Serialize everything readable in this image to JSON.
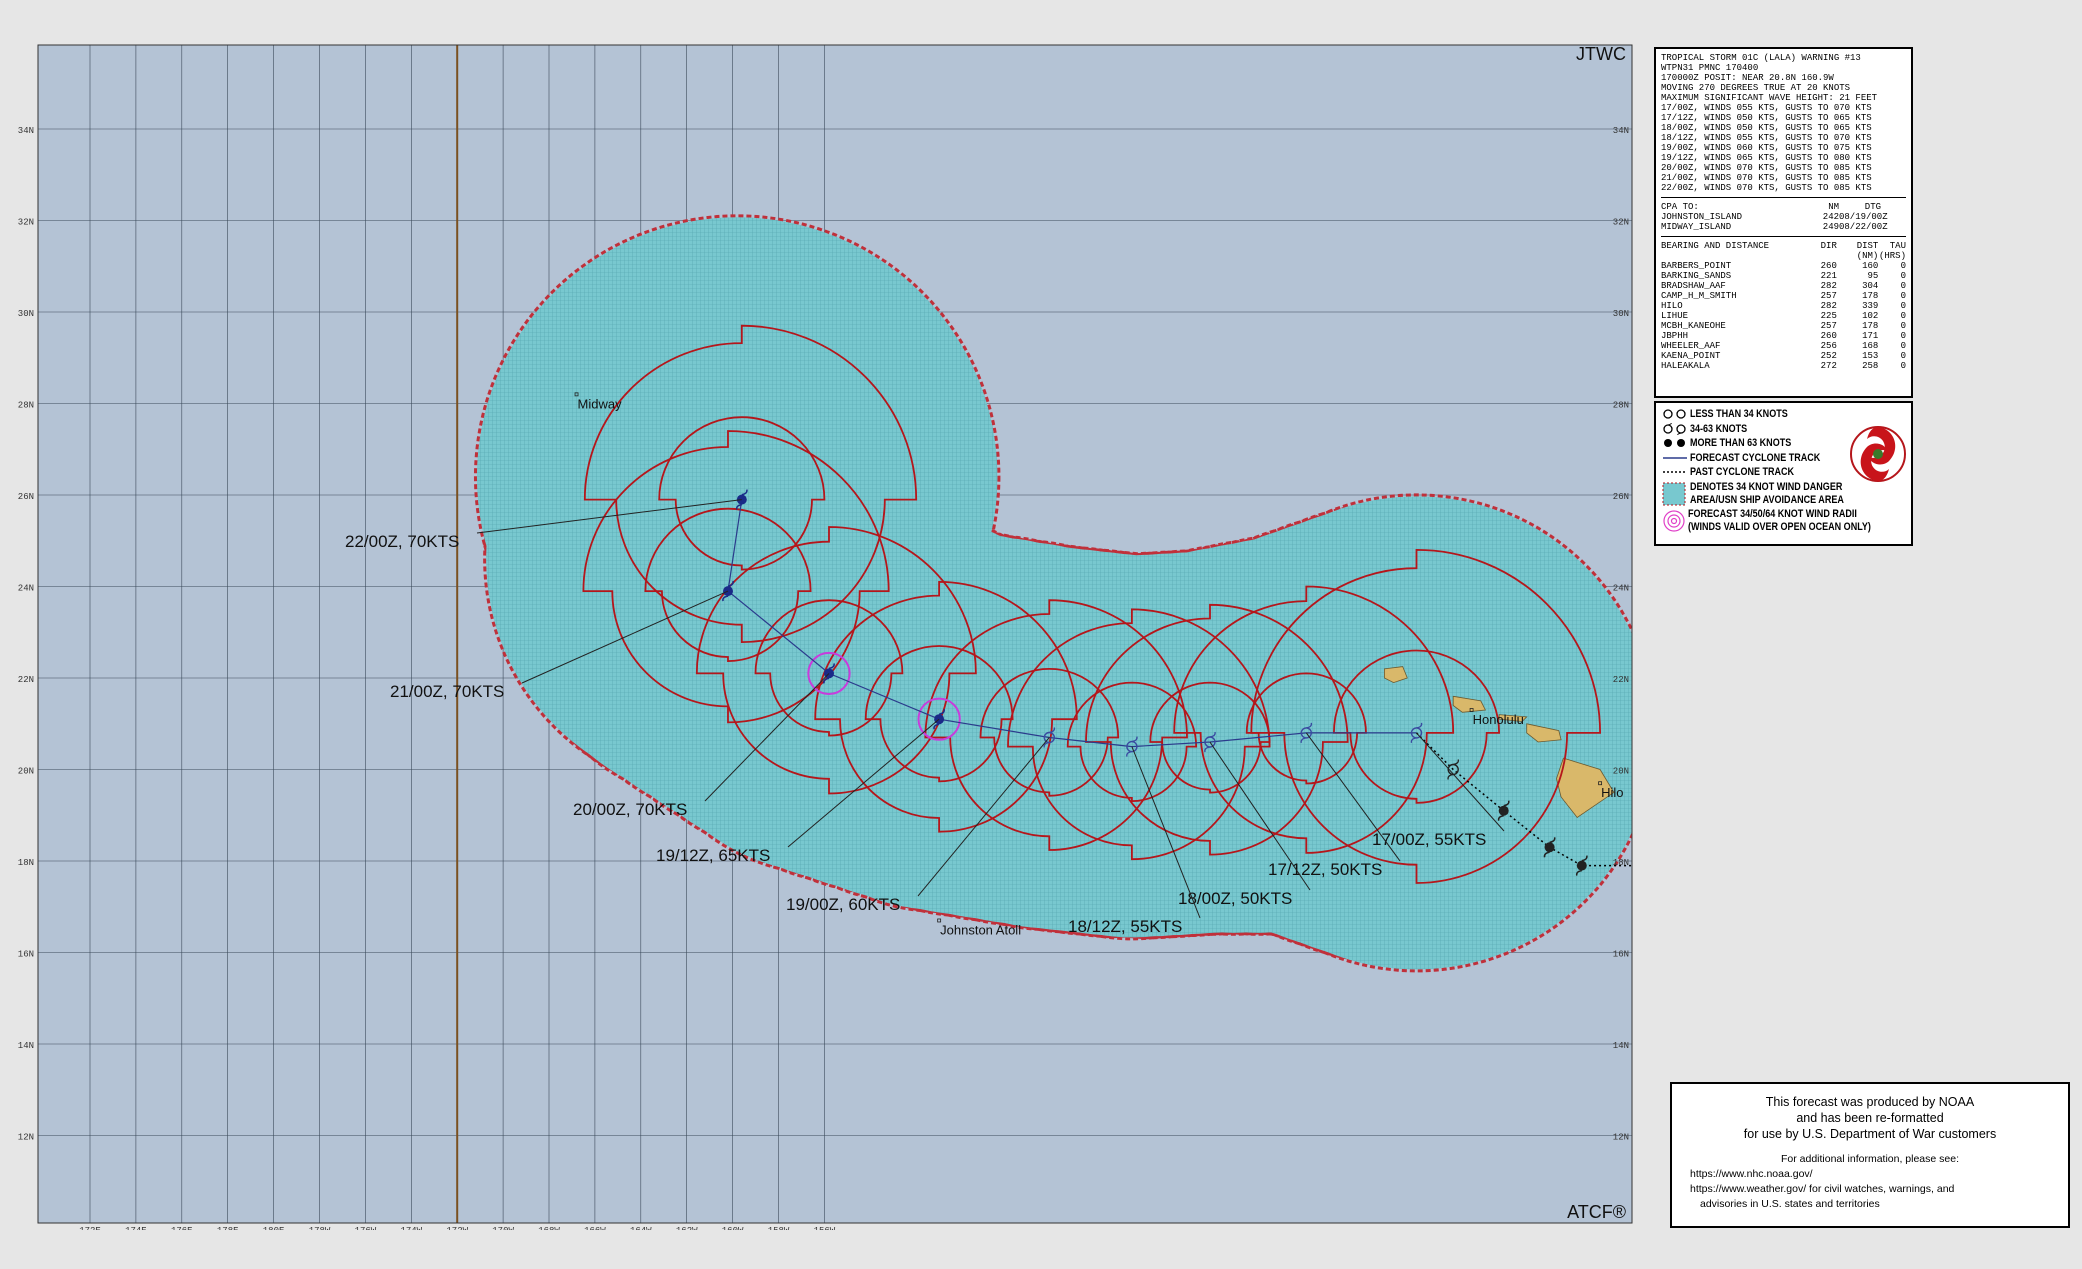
{
  "map": {
    "agency": "JTWC",
    "producer": "ATCF®",
    "lat_labels": [
      "34N",
      "32N",
      "30N",
      "28N",
      "26N",
      "24N",
      "22N",
      "20N",
      "18N",
      "16N",
      "14N",
      "12N"
    ],
    "lon_labels": [
      "172E",
      "174E",
      "176E",
      "178E",
      "180E",
      "178W",
      "176W",
      "174W",
      "172W",
      "170W",
      "168W",
      "166W",
      "164W",
      "162W",
      "160W",
      "158W",
      "156W"
    ],
    "places": [
      {
        "name": "Midway",
        "lon": -177.4,
        "lat": 28.2
      },
      {
        "name": "Johnston Atoll",
        "lon": -169.5,
        "lat": 16.7
      },
      {
        "name": "Honolulu",
        "lon": -157.9,
        "lat": 21.3
      },
      {
        "name": "Hilo",
        "lon": -155.1,
        "lat": 19.7
      }
    ],
    "colors": {
      "ocean": "#b4c3d5",
      "grid": "#3b4a5a",
      "danger": "#78c8cf",
      "radii": "#b5161b",
      "track": "#2b3b8c",
      "land": "#d9b86a",
      "dateline": "#7a5020"
    }
  },
  "forecast_points": [
    {
      "label": "17/00Z,  55KTS",
      "lon": -159.1,
      "lat": 20.8,
      "r34": 4.0,
      "r50": 1.8
    },
    {
      "label": "17/12Z,  50KTS",
      "lon": -161.5,
      "lat": 20.8,
      "r34": 3.2,
      "r50": 1.3
    },
    {
      "label": "18/00Z,  50KTS",
      "lon": -163.6,
      "lat": 20.6,
      "r34": 3.0,
      "r50": 1.3
    },
    {
      "label": "18/12Z,  55KTS",
      "lon": -165.3,
      "lat": 20.5,
      "r34": 3.0,
      "r50": 1.4
    },
    {
      "label": "19/00Z,  60KTS",
      "lon": -167.1,
      "lat": 20.7,
      "r34": 3.0,
      "r50": 1.5
    },
    {
      "label": "19/12Z,  65KTS",
      "lon": -169.5,
      "lat": 21.1,
      "r34": 3.0,
      "r50": 1.6
    },
    {
      "label": "20/00Z,  70KTS",
      "lon": -171.9,
      "lat": 22.1,
      "r34": 3.2,
      "r50": 1.6
    },
    {
      "label": "21/00Z,  70KTS",
      "lon": -174.1,
      "lat": 23.9,
      "r34": 3.5,
      "r50": 1.8
    },
    {
      "label": "22/00Z,  70KTS",
      "lon": -173.8,
      "lat": 25.9,
      "r34": 3.8,
      "r50": 1.8
    }
  ],
  "past_track": [
    {
      "lon": -158.3,
      "lat": 20.0
    },
    {
      "lon": -157.2,
      "lat": 19.1
    },
    {
      "lon": -156.2,
      "lat": 18.3
    },
    {
      "lon": -155.5,
      "lat": 17.9
    }
  ],
  "info": {
    "header": [
      "TROPICAL STORM 01C (LALA) WARNING #13",
      "WTPN31 PMNC 170400",
      "170000Z POSIT: NEAR 20.8N 160.9W",
      "MOVING 270 DEGREES TRUE AT 20 KNOTS",
      "MAXIMUM SIGNIFICANT WAVE HEIGHT: 21 FEET",
      "17/00Z, WINDS 055 KTS, GUSTS TO 070 KTS",
      "17/12Z, WINDS 050 KTS, GUSTS TO 065 KTS",
      "18/00Z, WINDS 050 KTS, GUSTS TO 065 KTS",
      "18/12Z, WINDS 055 KTS, GUSTS TO 070 KTS",
      "19/00Z, WINDS 060 KTS, GUSTS TO 075 KTS",
      "19/12Z, WINDS 065 KTS, GUSTS TO 080 KTS",
      "20/00Z, WINDS 070 KTS, GUSTS TO 085 KTS",
      "21/00Z, WINDS 070 KTS, GUSTS TO 085 KTS",
      "22/00Z, WINDS 070 KTS, GUSTS TO 085 KTS"
    ],
    "cpa_header": [
      "CPA TO:",
      "NM",
      "DTG"
    ],
    "cpa": [
      [
        "JOHNSTON_ISLAND",
        "242",
        "08/19/00Z"
      ],
      [
        "MIDWAY_ISLAND",
        "249",
        "08/22/00Z"
      ]
    ],
    "bd_header": [
      "BEARING AND DISTANCE",
      "DIR",
      "DIST",
      "TAU"
    ],
    "bd_units": [
      "",
      "",
      "(NM)",
      "(HRS)"
    ],
    "bd": [
      [
        "BARBERS_POINT",
        "260",
        "160",
        "0"
      ],
      [
        "BARKING_SANDS",
        "221",
        "95",
        "0"
      ],
      [
        "BRADSHAW_AAF",
        "282",
        "304",
        "0"
      ],
      [
        "CAMP_H_M_SMITH",
        "257",
        "178",
        "0"
      ],
      [
        "HILO",
        "282",
        "339",
        "0"
      ],
      [
        "LIHUE",
        "225",
        "102",
        "0"
      ],
      [
        "MCBH_KANEOHE",
        "257",
        "178",
        "0"
      ],
      [
        "JBPHH",
        "260",
        "171",
        "0"
      ],
      [
        "WHEELER_AAF",
        "256",
        "168",
        "0"
      ],
      [
        "KAENA_POINT",
        "252",
        "153",
        "0"
      ],
      [
        "HALEAKALA",
        "272",
        "258",
        "0"
      ]
    ]
  },
  "legend": {
    "items": [
      "LESS THAN 34 KNOTS",
      "34-63 KNOTS",
      "MORE THAN 63 KNOTS",
      "FORECAST CYCLONE TRACK",
      "PAST CYCLONE TRACK"
    ],
    "danger": [
      "DENOTES 34 KNOT WIND DANGER",
      "AREA/USN SHIP AVOIDANCE AREA"
    ],
    "radii": [
      "FORECAST 34/50/64 KNOT WIND RADII",
      "(WINDS VALID OVER OPEN OCEAN ONLY)"
    ]
  },
  "notice": {
    "lines": [
      "This forecast was produced by NOAA",
      "and has been re-formatted",
      "for use by U.S. Department of War customers"
    ],
    "more": "For additional information, please see:",
    "links": [
      "https://www.nhc.noaa.gov/",
      "https://www.weather.gov/ for civil watches, warnings, and",
      "advisories in U.S. states and territories"
    ]
  }
}
